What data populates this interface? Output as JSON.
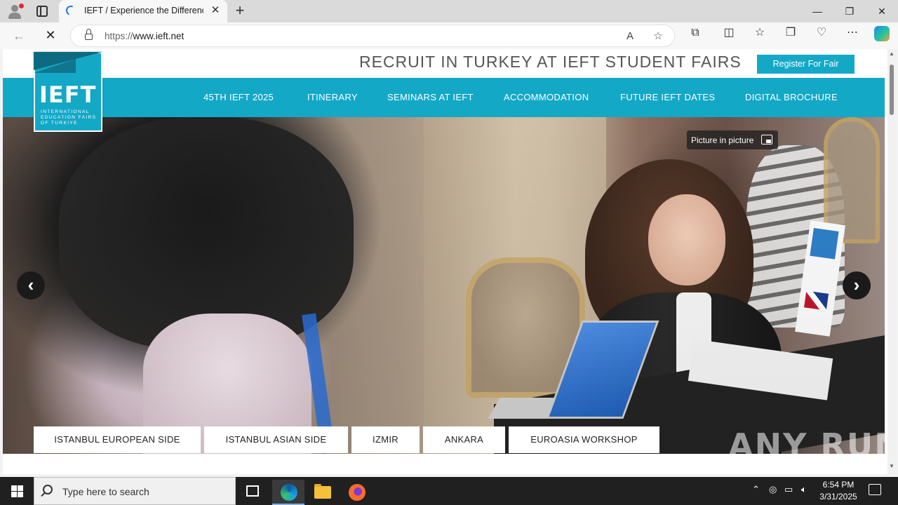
{
  "browser": {
    "tab_title": "IEFT / Experience the Difference...",
    "close_tab": "✕",
    "new_tab": "+",
    "window_controls": {
      "minimize": "—",
      "restore": "❐",
      "close": "✕"
    },
    "url_host_prefix": "https://",
    "url_host": "www.ieft.net",
    "back": "←",
    "reload_stop": "✕"
  },
  "site": {
    "logo_text": "IEFT",
    "logo_subtitle": "INTERNATIONAL EDUCATION FAIRS OF TURKIYE",
    "headline": "RECRUIT IN TURKEY AT IEFT STUDENT FAIRS",
    "register_button": "Register For Fair",
    "nav": [
      {
        "label": "45TH IEFT 2025"
      },
      {
        "label": "ITINERARY"
      },
      {
        "label": "SEMINARS AT IEFT"
      },
      {
        "label": "ACCOMMODATION"
      },
      {
        "label": "FUTURE IEFT DATES"
      },
      {
        "label": "DIGITAL BROCHURE"
      }
    ],
    "pip_label": "Picture in picture",
    "prev_arrow": "‹",
    "next_arrow": "›",
    "city_tabs": [
      {
        "label": "ISTANBUL EUROPEAN SIDE"
      },
      {
        "label": "ISTANBUL ASIAN SIDE"
      },
      {
        "label": "IZMIR"
      },
      {
        "label": "ANKARA"
      },
      {
        "label": "EUROASIA WORKSHOP"
      }
    ],
    "watermark": "ANY RUN"
  },
  "taskbar": {
    "search_placeholder": "Type here to search",
    "time": "6:54 PM",
    "date": "3/31/2025"
  },
  "colors": {
    "brand_teal": "#14a8c7",
    "taskbar_bg": "#202020"
  }
}
